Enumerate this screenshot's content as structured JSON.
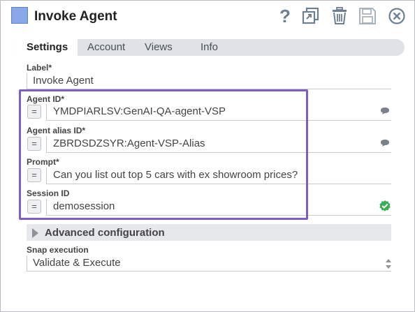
{
  "window": {
    "title": "Invoke Agent"
  },
  "toolbar": {
    "help_icon": "help-icon",
    "copy_icon": "copy-icon",
    "delete_icon": "trash-icon",
    "save_icon": "save-icon",
    "close_icon": "close-icon"
  },
  "tabs": [
    {
      "label": "Settings",
      "active": true
    },
    {
      "label": "Account",
      "active": false
    },
    {
      "label": "Views",
      "active": false
    },
    {
      "label": "Info",
      "active": false
    }
  ],
  "fields": {
    "label": {
      "label": "Label*",
      "value": "Invoke Agent"
    },
    "agent_id": {
      "label": "Agent ID*",
      "value": "YMDPIARLSV:GenAI-QA-agent-VSP",
      "expr": "="
    },
    "agent_alias_id": {
      "label": "Agent alias ID*",
      "value": "ZBRDSDZSYR:Agent-VSP-Alias",
      "expr": "="
    },
    "prompt": {
      "label": "Prompt*",
      "value": "Can you list out top 5 cars with ex showroom prices?",
      "expr": "="
    },
    "session_id": {
      "label": "Session ID",
      "value": "demosession",
      "expr": "="
    }
  },
  "advanced": {
    "label": "Advanced configuration"
  },
  "snap_execution": {
    "label": "Snap execution",
    "value": "Validate & Execute"
  },
  "colors": {
    "highlight_border": "#7d5dc6",
    "valid_check": "#3cae5a",
    "snap_icon": "#8aa8e8"
  }
}
